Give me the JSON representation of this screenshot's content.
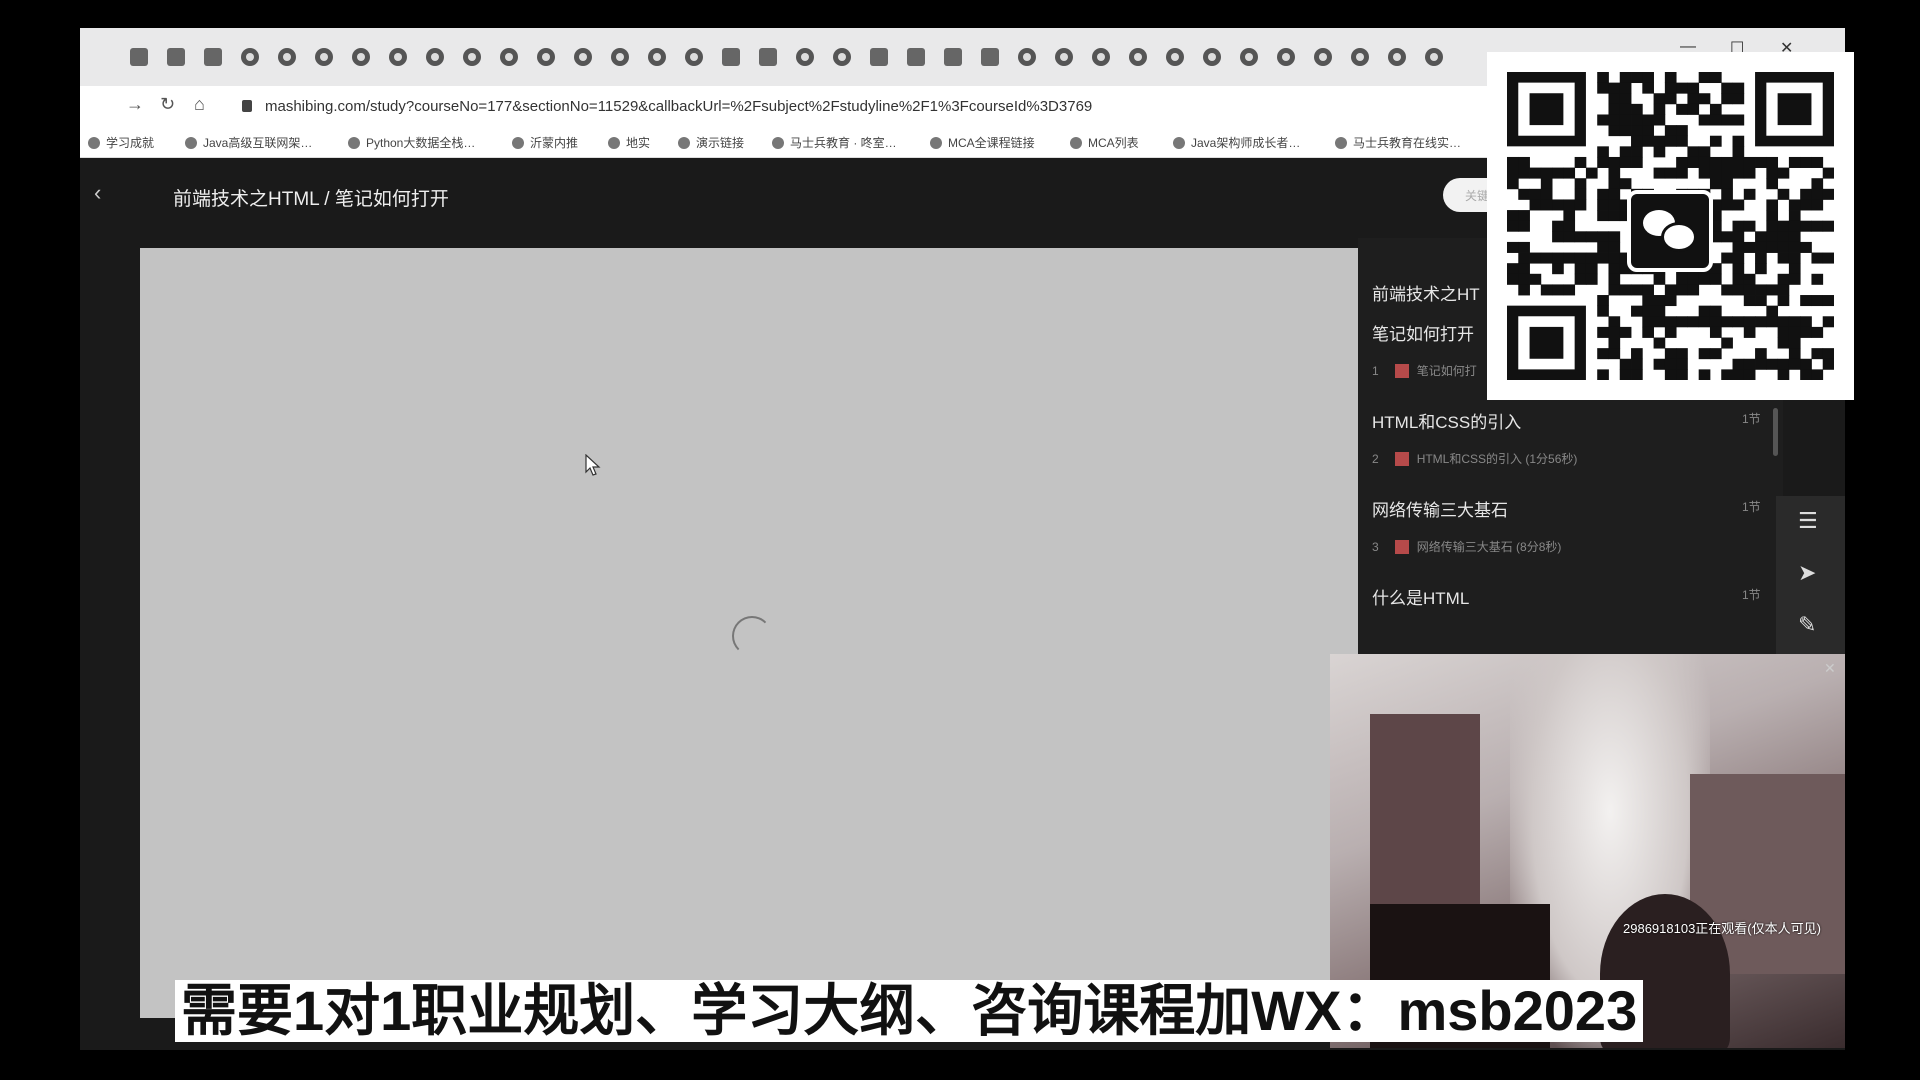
{
  "browser": {
    "url": "mashibing.com/study?courseNo=177&sectionNo=11529&callbackUrl=%2Fsubject%2Fstudyline%2F1%3FcourseId%3D3769",
    "bookmarks": [
      "学习成就",
      "Java高级互联网架…",
      "Python大数据全栈…",
      "沂蒙内推",
      "地实",
      "演示链接",
      "马士兵教育 · 咚室…",
      "MCA全课程链接",
      "MCA列表",
      "Java架构师成长者…",
      "马士兵教育在线实…"
    ]
  },
  "page": {
    "breadcrumb": "前端技术之HTML / 笔记如何打开",
    "search_placeholder": "关键"
  },
  "chapters": {
    "course_title": "前端技术之HT",
    "sections": [
      {
        "title": "笔记如何打开",
        "lesson": {
          "num": "1",
          "label": "笔记如何打"
        }
      },
      {
        "title": "HTML和CSS的引入",
        "count": "1节",
        "lesson": {
          "num": "2",
          "label": "HTML和CSS的引入 (1分56秒)"
        }
      },
      {
        "title": "网络传输三大基石",
        "count": "1节",
        "lesson": {
          "num": "3",
          "label": "网络传输三大基石 (8分8秒)"
        }
      },
      {
        "title": "什么是HTML",
        "count": "1节"
      }
    ]
  },
  "webcam": {
    "watch_note": "2986918103正在观看(仅本人可见)"
  },
  "caption": {
    "text": "需要1对1职业规划、学习大纲、咨询课程加WX：msb2023"
  },
  "colors": {
    "player_bg": "#c3c3c3",
    "page_bg": "#1a1a1a",
    "lesson_icon": "#b64a4a"
  }
}
